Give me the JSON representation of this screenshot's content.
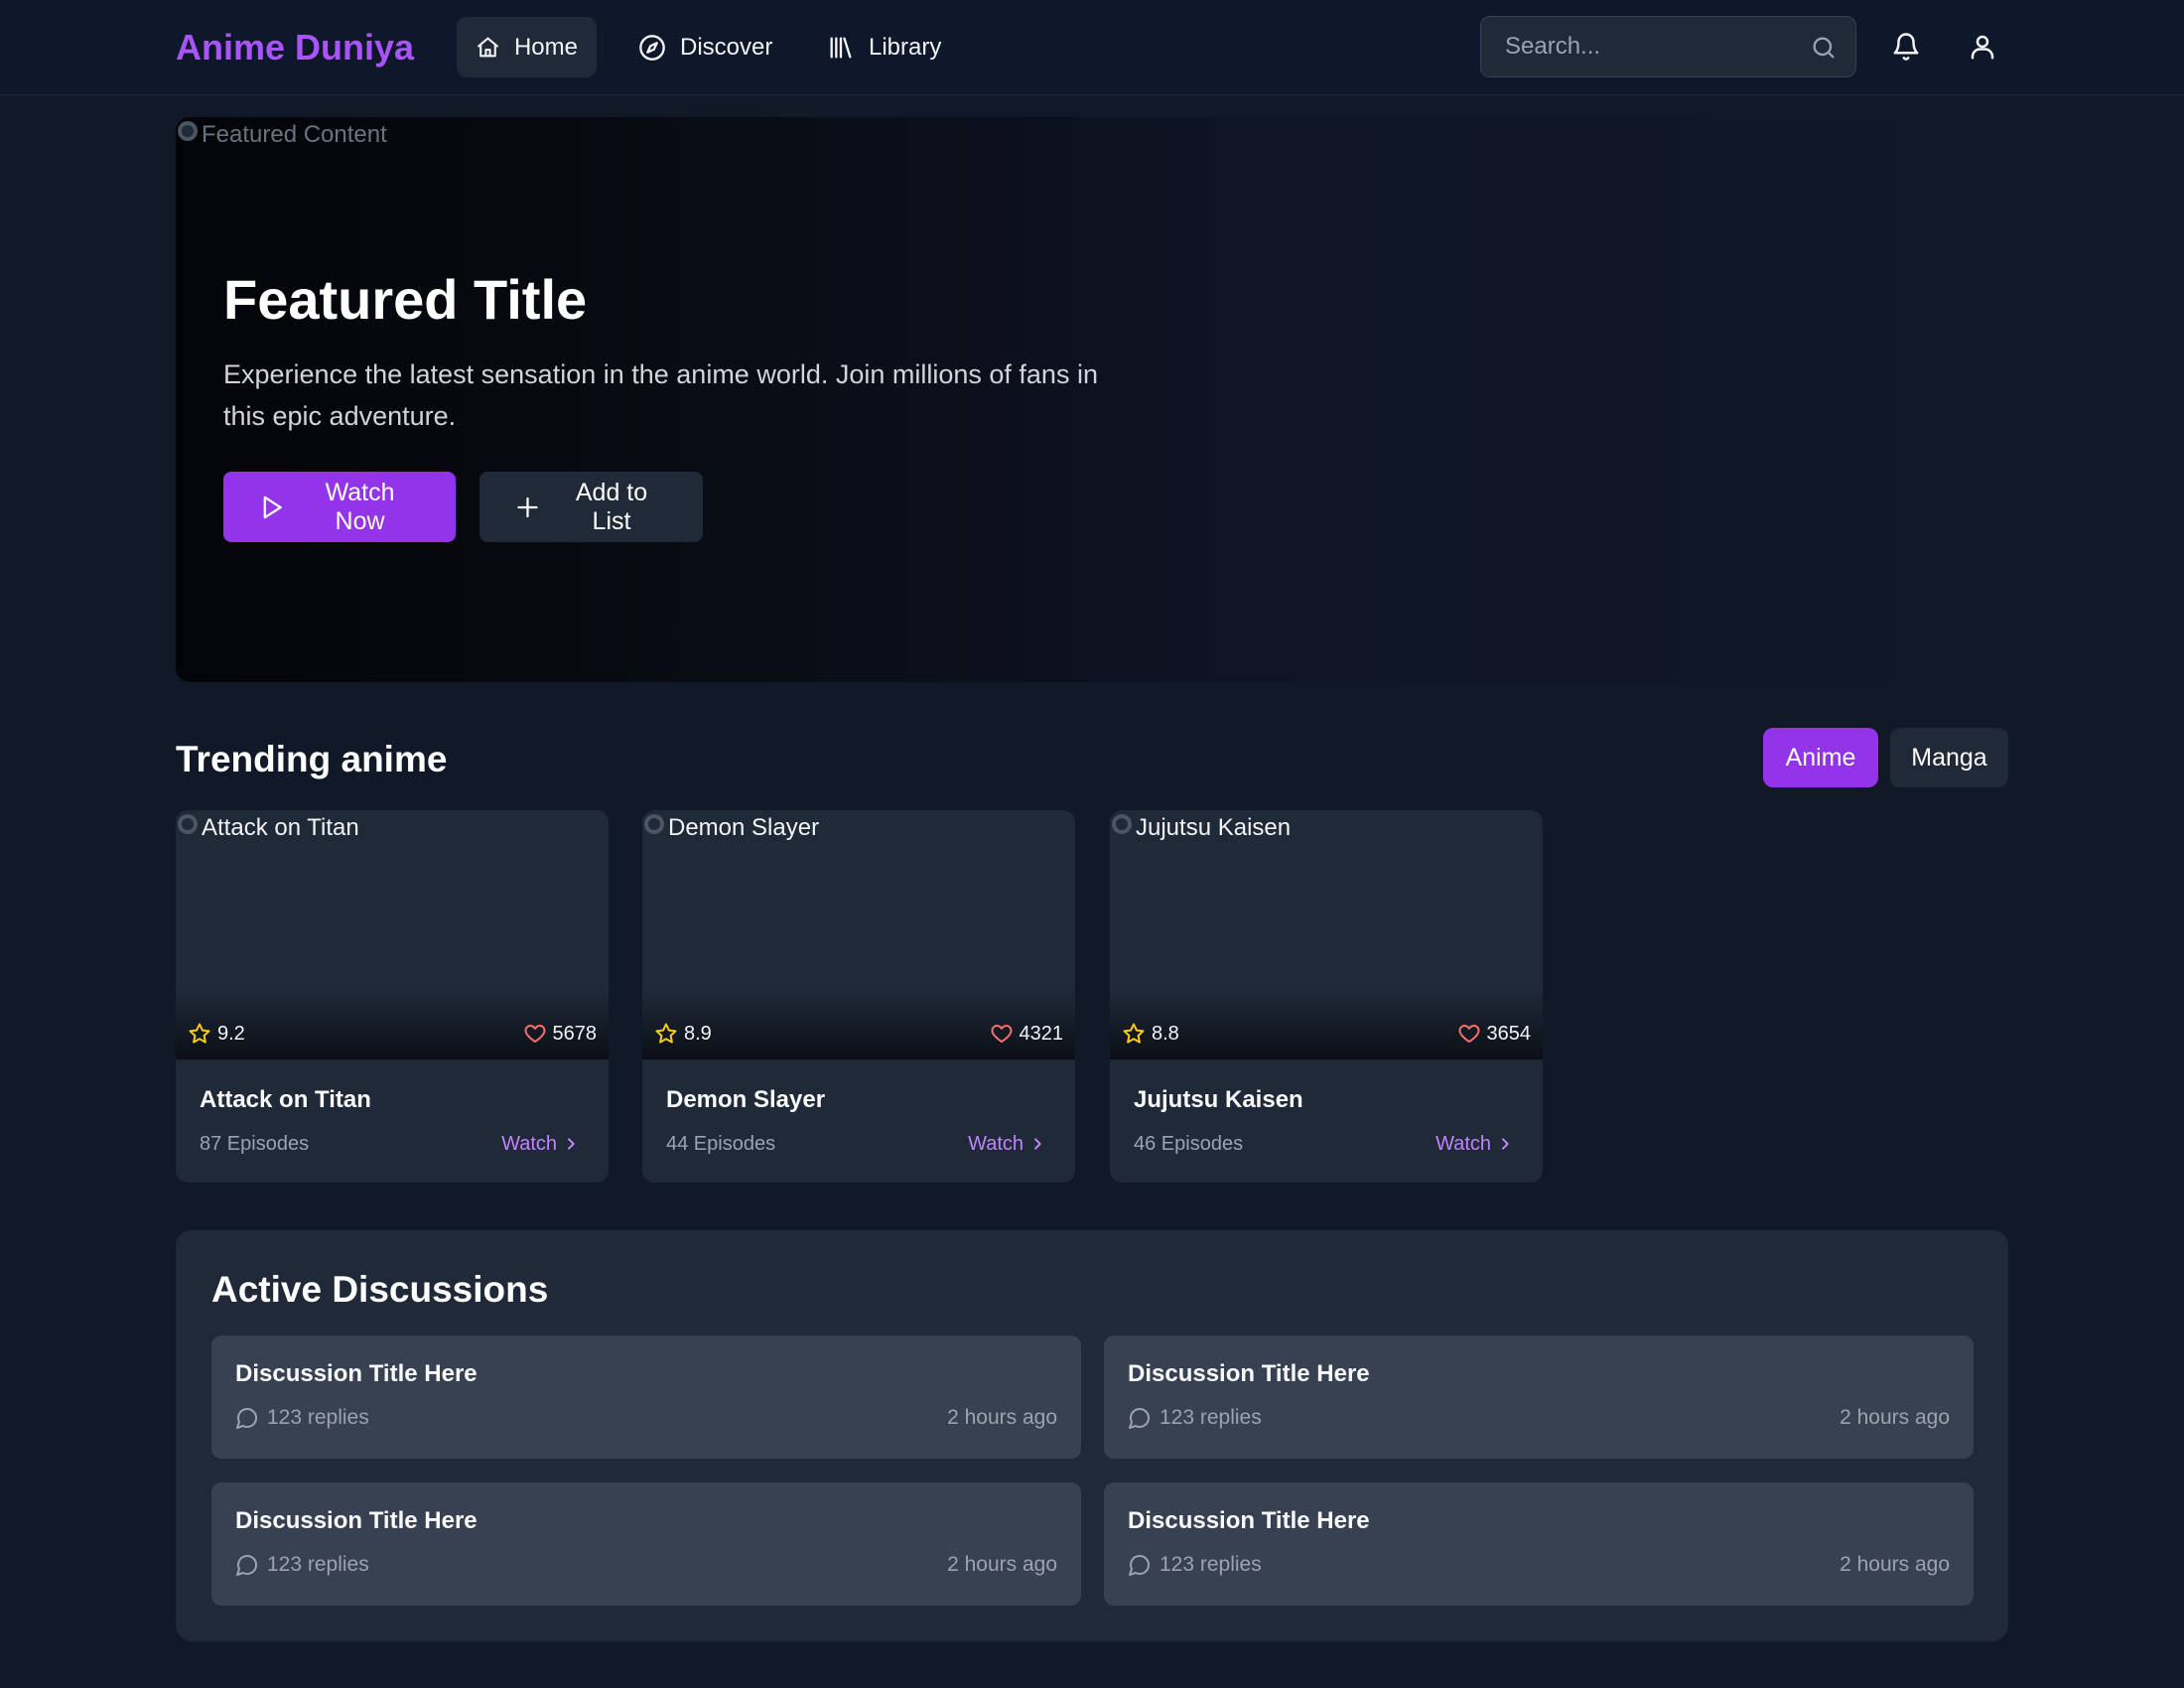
{
  "brand": {
    "name": "Anime Duniya",
    "color": "#a855f7"
  },
  "nav": {
    "items": [
      {
        "label": "Home",
        "icon": "home-icon",
        "active": true
      },
      {
        "label": "Discover",
        "icon": "compass-icon",
        "active": false
      },
      {
        "label": "Library",
        "icon": "library-icon",
        "active": false
      }
    ]
  },
  "search": {
    "placeholder": "Search...",
    "value": "",
    "icon": "search-icon"
  },
  "header_icons": [
    "bell-icon",
    "user-icon"
  ],
  "hero": {
    "image_alt": "Featured Content",
    "title": "Featured Title",
    "description": "Experience the latest sensation in the anime world. Join millions of fans in this epic adventure.",
    "primary_button": "Watch Now",
    "secondary_button": "Add to List"
  },
  "trending": {
    "title": "Trending anime",
    "tabs": [
      {
        "label": "Anime",
        "active": true
      },
      {
        "label": "Manga",
        "active": false
      }
    ],
    "cards": [
      {
        "image_alt": "Attack on Titan",
        "title": "Attack on Titan",
        "rating": "9.2",
        "likes": "5678",
        "episodes": "87 Episodes",
        "watch_label": "Watch"
      },
      {
        "image_alt": "Demon Slayer",
        "title": "Demon Slayer",
        "rating": "8.9",
        "likes": "4321",
        "episodes": "44 Episodes",
        "watch_label": "Watch"
      },
      {
        "image_alt": "Jujutsu Kaisen",
        "title": "Jujutsu Kaisen",
        "rating": "8.8",
        "likes": "3654",
        "episodes": "46 Episodes",
        "watch_label": "Watch"
      }
    ]
  },
  "discussions": {
    "title": "Active Discussions",
    "items": [
      {
        "title": "Discussion Title Here",
        "replies": "123 replies",
        "time": "2 hours ago"
      },
      {
        "title": "Discussion Title Here",
        "replies": "123 replies",
        "time": "2 hours ago"
      },
      {
        "title": "Discussion Title Here",
        "replies": "123 replies",
        "time": "2 hours ago"
      },
      {
        "title": "Discussion Title Here",
        "replies": "123 replies",
        "time": "2 hours ago"
      }
    ]
  },
  "colors": {
    "accent": "#9333ea",
    "accent_text": "#c084fc",
    "background": "#111827",
    "surface": "#1f2937",
    "surface_alt": "#374151",
    "star": "#facc15",
    "heart": "#f87171"
  }
}
